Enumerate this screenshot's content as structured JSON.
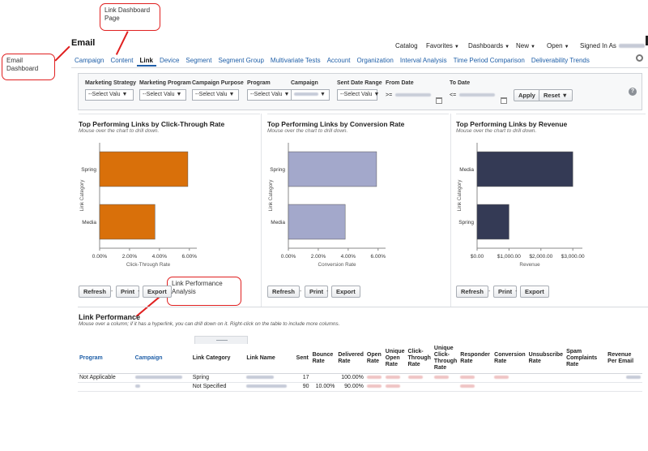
{
  "callouts": {
    "dashboard_page": "Link Dashboard Page",
    "email_dashboard": "Email Dashboard",
    "performance_analysis": "Link Performance Analysis"
  },
  "app_title": "Email",
  "topnav": {
    "catalog": "Catalog",
    "favorites": "Favorites",
    "dashboards": "Dashboards",
    "new": "New",
    "open": "Open",
    "signed_in_as": "Signed In As"
  },
  "tabs": [
    "Campaign",
    "Content",
    "Link",
    "Device",
    "Segment",
    "Segment Group",
    "Multivariate Tests",
    "Account",
    "Organization",
    "Interval Analysis",
    "Time Period Comparison",
    "Deliverability Trends"
  ],
  "active_tab": "Link",
  "filters": {
    "marketing_strategy": {
      "label": "Marketing Strategy",
      "value": "--Select Valu"
    },
    "marketing_program": {
      "label": "Marketing Program",
      "value": "--Select Valu"
    },
    "campaign_purpose": {
      "label": "Campaign Purpose",
      "value": "--Select Valu"
    },
    "program": {
      "label": "Program",
      "value": "--Select Valu"
    },
    "campaign": {
      "label": "Campaign",
      "value": ""
    },
    "sent_date_range": {
      "label": "Sent Date Range",
      "value": "--Select Valu"
    },
    "from_date": {
      "label": "From Date",
      "prefix": ">="
    },
    "to_date": {
      "label": "To Date",
      "prefix": "<="
    },
    "apply": "Apply",
    "reset": "Reset"
  },
  "chart_controls": {
    "refresh": "Refresh",
    "print": "Print",
    "export": "Export",
    "sep": "-"
  },
  "chart_data": [
    {
      "type": "bar",
      "orientation": "horizontal",
      "title": "Top Performing Links by Click-Through Rate",
      "subtitle": "Mouse over the chart to drill down.",
      "categories": [
        "Spring",
        "Media"
      ],
      "values": [
        5.9,
        3.7
      ],
      "xlabel": "Click-Through Rate",
      "ylabel": "Link Category",
      "xlim": [
        0,
        6.5
      ],
      "ticks": [
        0,
        2,
        4,
        6
      ],
      "tick_labels": [
        "0.00%",
        "2.00%",
        "4.00%",
        "6.00%"
      ],
      "color": "#d9700a"
    },
    {
      "type": "bar",
      "orientation": "horizontal",
      "title": "Top Performing Links by Conversion Rate",
      "subtitle": "Mouse over the chart to drill down.",
      "categories": [
        "Spring",
        "Media"
      ],
      "values": [
        5.9,
        3.8
      ],
      "xlabel": "Conversion Rate",
      "ylabel": "Link Category",
      "xlim": [
        0,
        6.5
      ],
      "ticks": [
        0,
        2,
        4,
        6
      ],
      "tick_labels": [
        "0.00%",
        "2.00%",
        "4.00%",
        "6.00%"
      ],
      "color": "#a3a8cb"
    },
    {
      "type": "bar",
      "orientation": "horizontal",
      "title": "Top Performing Links by Revenue",
      "subtitle": "Mouse over the chart to drill down.",
      "categories": [
        "Media",
        "Spring"
      ],
      "values": [
        3000,
        1000
      ],
      "xlabel": "Revenue",
      "ylabel": "Link Category",
      "xlim": [
        0,
        3300
      ],
      "ticks": [
        0,
        1000,
        2000,
        3000
      ],
      "tick_labels": [
        "$0.00",
        "$1,000.00",
        "$2,000.00",
        "$3,000.00"
      ],
      "color": "#343a55"
    }
  ],
  "performance": {
    "title": "Link Performance",
    "subtitle": "Mouse over a column; if it has a hyperlink, you can drill down on it. Right-click on the table to include more columns.",
    "headers": [
      "Program",
      "Campaign",
      "Link Category",
      "Link Name",
      "Sent",
      "Bounce Rate",
      "Delivered Rate",
      "Open Rate",
      "Unique Open Rate",
      "Click-Through Rate",
      "Unique Click-Through Rate",
      "Responder Rate",
      "Conversion Rate",
      "Unsubscribe Rate",
      "Spam Complaints Rate",
      "Revenue Per Email"
    ],
    "rows": [
      {
        "program": "Not Applicable",
        "link_category": "Spring",
        "sent": "17",
        "bounce": "",
        "delivered": "100.00%"
      },
      {
        "program": "",
        "link_category": "Not Specified",
        "sent": "90",
        "bounce": "10.00%",
        "delivered": "90.00%"
      }
    ]
  }
}
